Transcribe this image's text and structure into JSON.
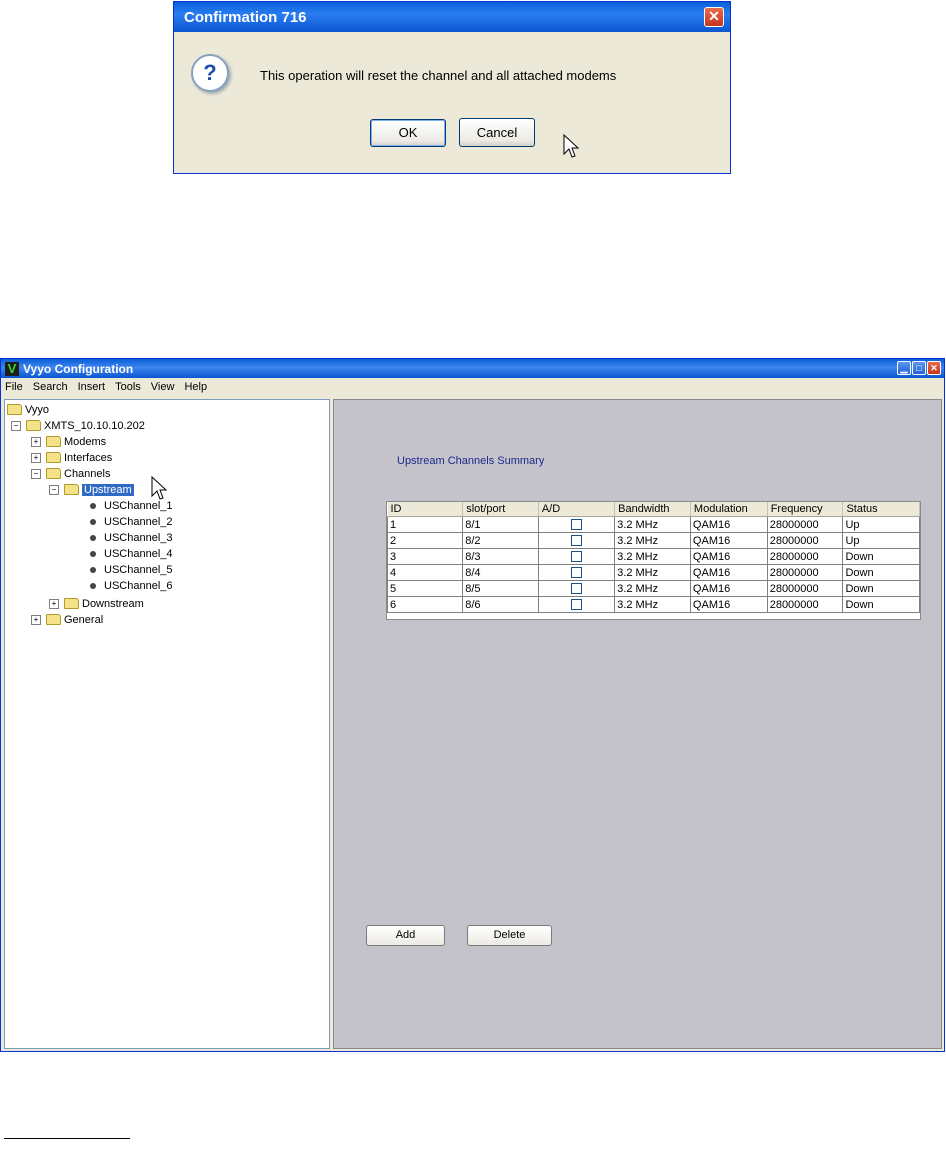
{
  "dialog": {
    "title": "Confirmation 716",
    "message": "This operation will reset the channel and all attached modems",
    "ok_label": "OK",
    "cancel_label": "Cancel",
    "question_glyph": "?"
  },
  "window": {
    "logo": "V",
    "title": "Vyyo Configuration",
    "menu": [
      "File",
      "Search",
      "Insert",
      "Tools",
      "View",
      "Help"
    ]
  },
  "tree": {
    "root": "Vyyo",
    "xmts": "XMTS_10.10.10.202",
    "modems": "Modems",
    "interfaces": "Interfaces",
    "channels": "Channels",
    "upstream": "Upstream",
    "us_channels": [
      "USChannel_1",
      "USChannel_2",
      "USChannel_3",
      "USChannel_4",
      "USChannel_5",
      "USChannel_6"
    ],
    "downstream": "Downstream",
    "general": "General"
  },
  "panel": {
    "title": "Upstream Channels Summary",
    "columns": [
      "ID",
      "slot/port",
      "A/D",
      "Bandwidth",
      "Modulation",
      "Frequency",
      "Status"
    ],
    "rows": [
      [
        "1",
        "8/1",
        "",
        "3.2 MHz",
        "QAM16",
        "28000000",
        "Up"
      ],
      [
        "2",
        "8/2",
        "",
        "3.2 MHz",
        "QAM16",
        "28000000",
        "Up"
      ],
      [
        "3",
        "8/3",
        "",
        "3.2 MHz",
        "QAM16",
        "28000000",
        "Down"
      ],
      [
        "4",
        "8/4",
        "",
        "3.2 MHz",
        "QAM16",
        "28000000",
        "Down"
      ],
      [
        "5",
        "8/5",
        "",
        "3.2 MHz",
        "QAM16",
        "28000000",
        "Down"
      ],
      [
        "6",
        "8/6",
        "",
        "3.2 MHz",
        "QAM16",
        "28000000",
        "Down"
      ]
    ],
    "add_label": "Add",
    "delete_label": "Delete"
  },
  "colors": {
    "title_bar": "#0a5fd8",
    "selection": "#316ac5",
    "panel_bg": "#c4c3cb",
    "panel_title": "#1a2a8a"
  }
}
